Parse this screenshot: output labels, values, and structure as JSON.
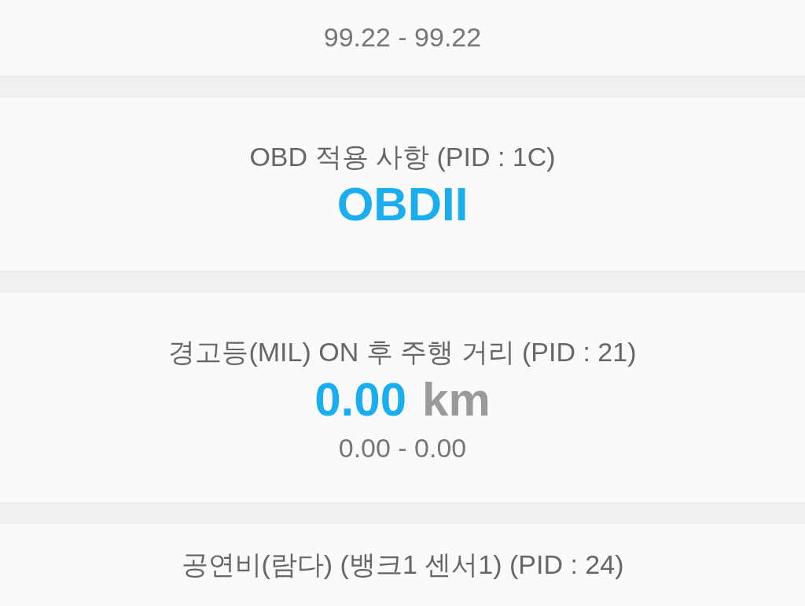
{
  "cards": [
    {
      "kind": "range",
      "range": "99.22 - 99.22"
    },
    {
      "kind": "text",
      "title": "OBD 적용 사항 (PID : 1C)",
      "value": "OBDII"
    },
    {
      "kind": "number",
      "title": "경고등(MIL) ON 후 주행 거리 (PID : 21)",
      "value": "0.00",
      "unit": "km",
      "range": "0.00 - 0.00"
    },
    {
      "kind": "title",
      "title": "공연비(람다) (뱅크1 센서1) (PID : 24)"
    }
  ]
}
